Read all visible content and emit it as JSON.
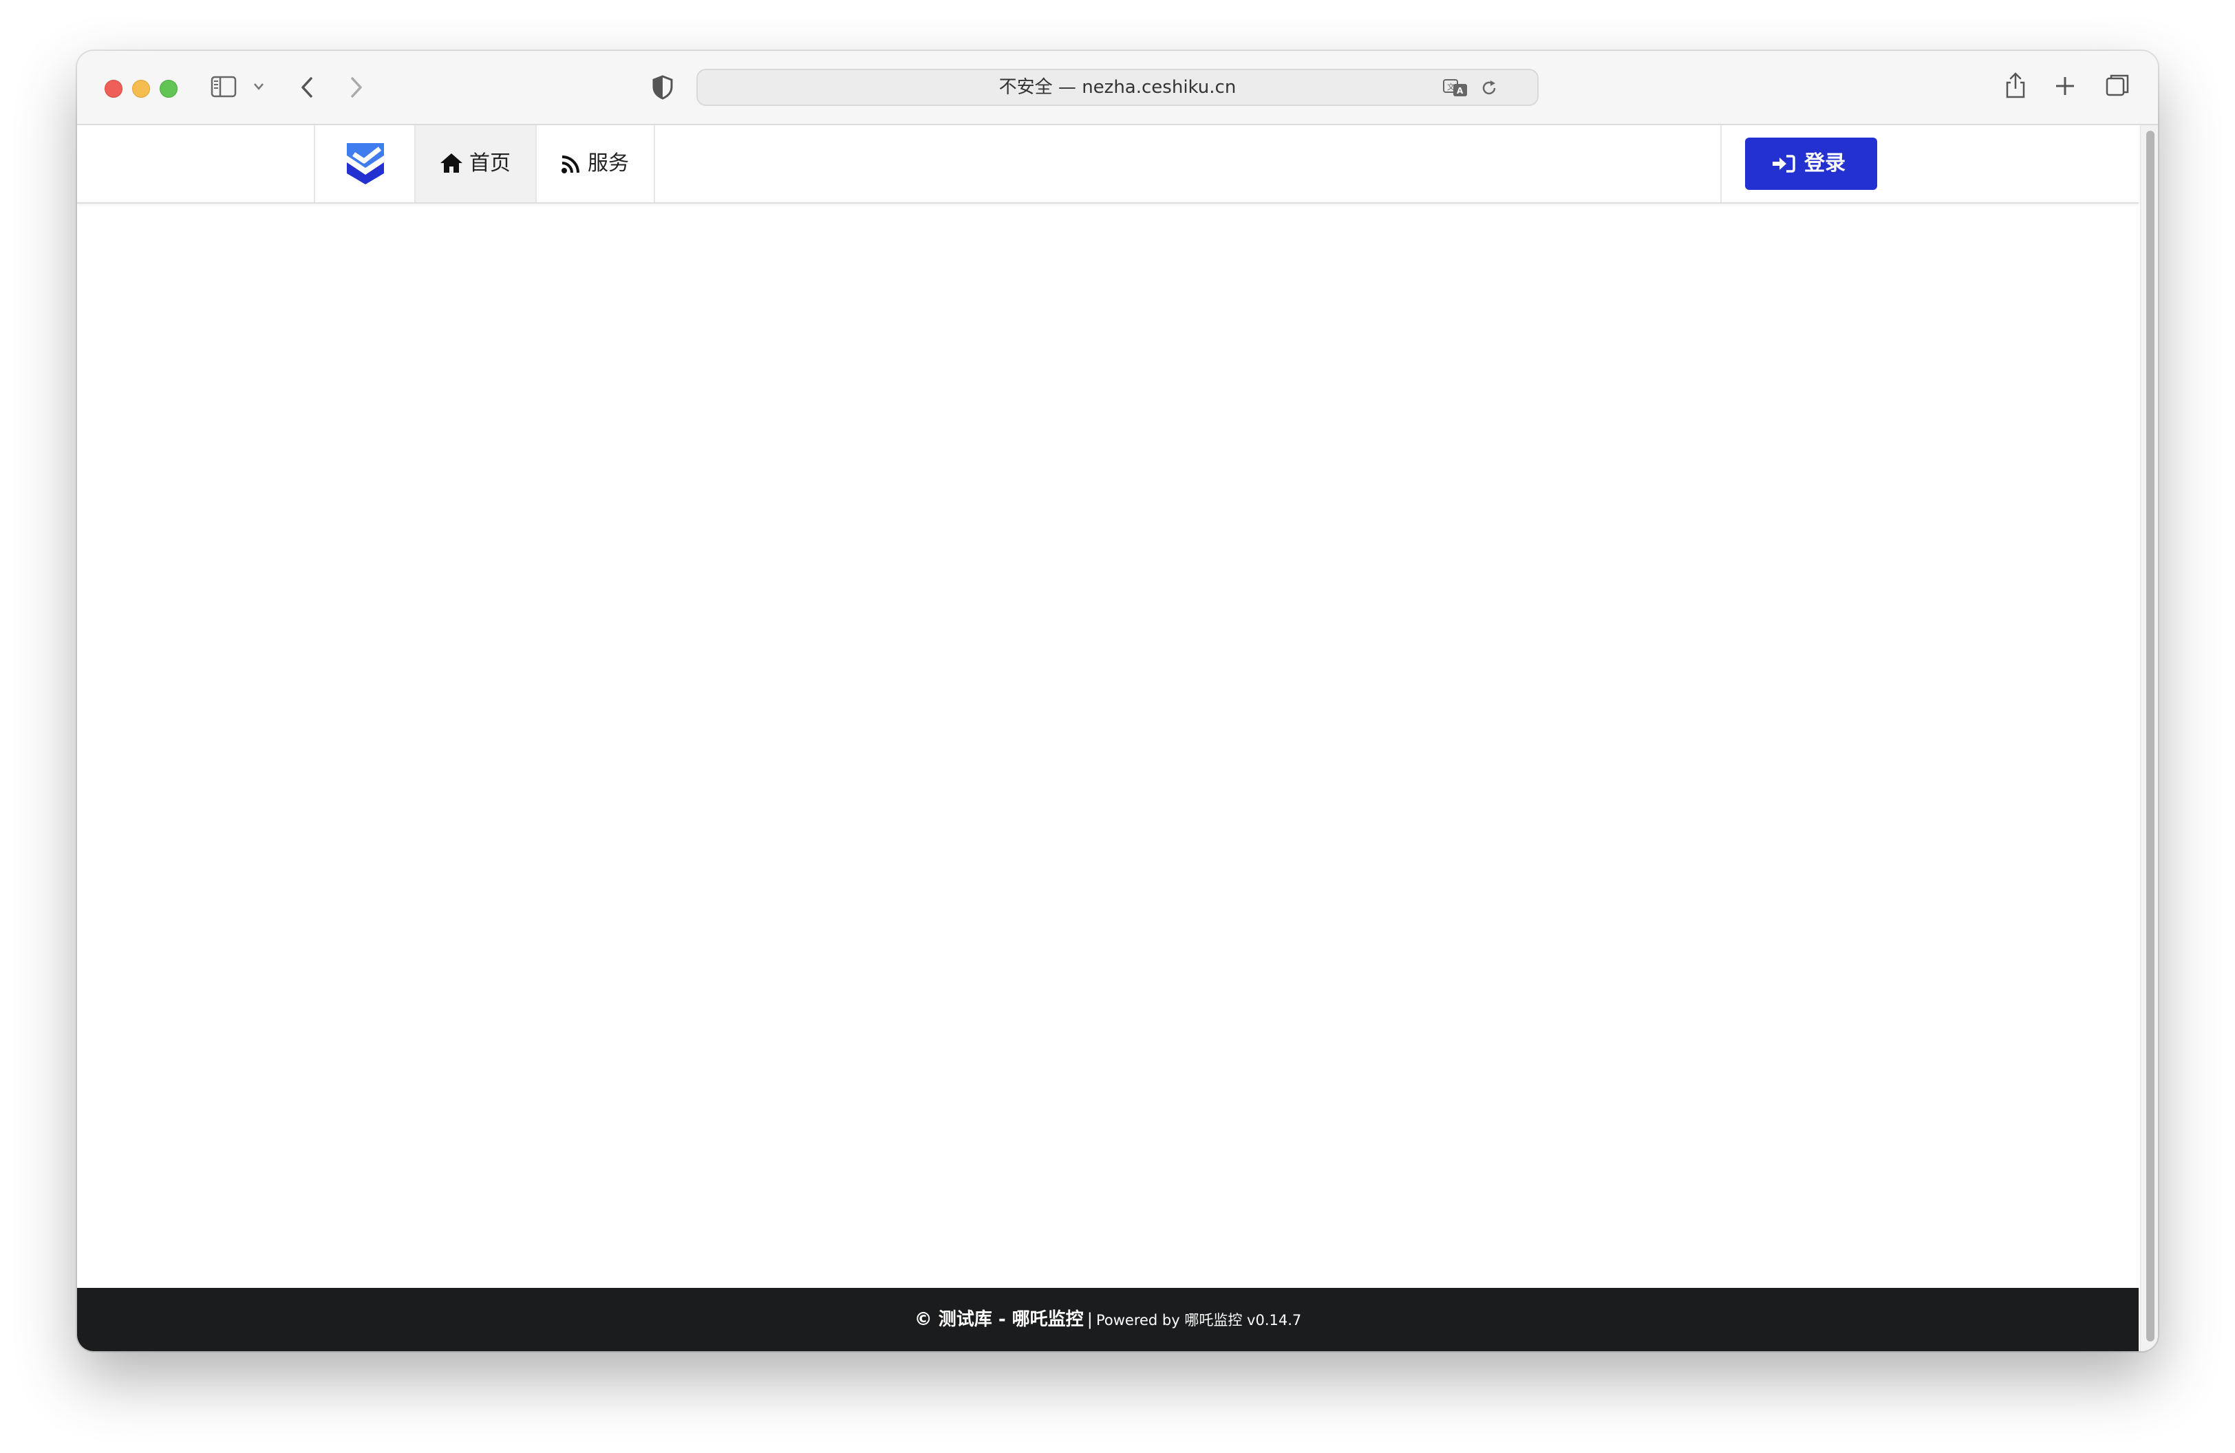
{
  "browser": {
    "address_text": "不安全 — nezha.ceshiku.cn",
    "icons": [
      "sidebar-icon",
      "chevron-down-icon",
      "back-icon",
      "forward-icon",
      "shield-icon",
      "translate-icon",
      "reload-icon",
      "share-icon",
      "new-tab-icon",
      "tabs-overview-icon"
    ]
  },
  "nav": {
    "logo_icon": "shield-check-logo",
    "items": [
      {
        "label": "首页",
        "icon": "home-icon",
        "active": true
      },
      {
        "label": "服务",
        "icon": "rss-icon",
        "active": false
      }
    ],
    "login_label": "登录",
    "login_icon": "sign-in-icon"
  },
  "footer": {
    "copyright": "© 测试库 - 哪吒监控",
    "separator": "|",
    "powered_by": "Powered by 哪吒监控 v0.14.7"
  },
  "colors": {
    "accent": "#2431d1",
    "footer_bg": "#1b1c1d",
    "logo_light": "#3e7cf0",
    "logo_dark": "#2431d1"
  }
}
